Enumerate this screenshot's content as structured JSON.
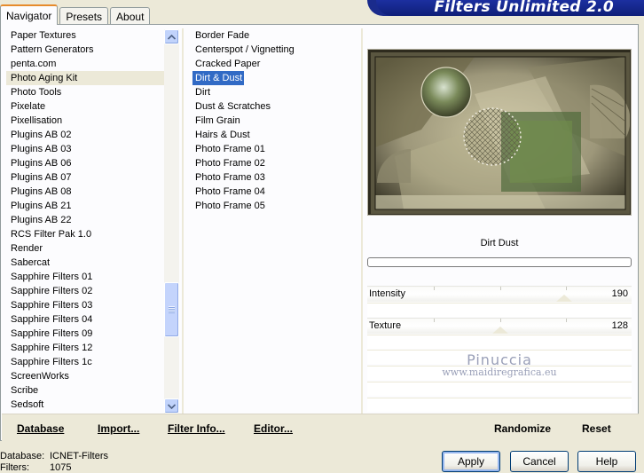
{
  "tabs": [
    "Navigator",
    "Presets",
    "About"
  ],
  "banner": "Filters Unlimited 2.0",
  "categories": [
    "Paper Textures",
    "Pattern Generators",
    "penta.com",
    "Photo Aging Kit",
    "Photo Tools",
    "Pixelate",
    "Pixellisation",
    "Plugins AB 02",
    "Plugins AB 03",
    "Plugins AB 06",
    "Plugins AB 07",
    "Plugins AB 08",
    "Plugins AB 21",
    "Plugins AB 22",
    "RCS Filter Pak 1.0",
    "Render",
    "Sabercat",
    "Sapphire Filters 01",
    "Sapphire Filters 02",
    "Sapphire Filters 03",
    "Sapphire Filters 04",
    "Sapphire Filters 09",
    "Sapphire Filters 12",
    "Sapphire Filters 1c",
    "ScreenWorks",
    "Scribe",
    "Sedsoft"
  ],
  "selected_category": "Photo Aging Kit",
  "filters": [
    "Border Fade",
    "Centerspot / Vignetting",
    "Cracked Paper",
    "Dirt & Dust",
    "Dirt",
    "Dust & Scratches",
    "Film Grain",
    "Hairs & Dust",
    "Photo Frame 01",
    "Photo Frame 02",
    "Photo Frame 03",
    "Photo Frame 04",
    "Photo Frame 05"
  ],
  "selected_filter": "Dirt & Dust",
  "filter_title": "Dirt  Dust",
  "sliders": [
    {
      "label": "Intensity",
      "value": "190",
      "fraction": 0.745
    },
    {
      "label": "Texture",
      "value": "128",
      "fraction": 0.502
    }
  ],
  "watermark": {
    "line1": "Pinuccia",
    "line2": "www.maidiregrafica.eu"
  },
  "links": {
    "database": "Database",
    "import": "Import...",
    "filter_info": "Filter Info...",
    "editor": "Editor...",
    "randomize": "Randomize",
    "reset": "Reset"
  },
  "status": {
    "database_label": "Database:",
    "database_value": "ICNET-Filters",
    "filters_label": "Filters:",
    "filters_value": "1075"
  },
  "buttons": {
    "apply": "Apply",
    "cancel": "Cancel",
    "help": "Help"
  }
}
